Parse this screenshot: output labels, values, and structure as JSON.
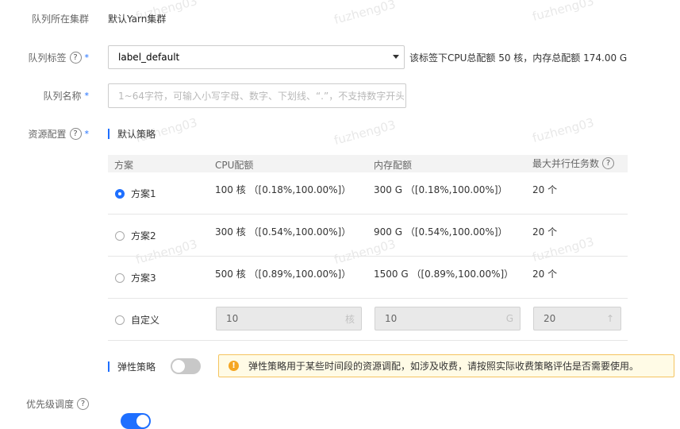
{
  "fields": {
    "cluster": {
      "label": "队列所在集群",
      "value": "默认Yarn集群"
    },
    "tag": {
      "label": "队列标签",
      "help": "?",
      "required": "*",
      "selected": "label_default",
      "note": "该标签下CPU总配额 50 核，内存总配额 174.00 G"
    },
    "name": {
      "label": "队列名称",
      "required": "*",
      "placeholder": "1~64字符，可输入小写字母、数字、下划线、“.”，不支持数字开头"
    },
    "resource": {
      "label": "资源配置",
      "help": "?",
      "required": "*",
      "section_title": "默认策略"
    }
  },
  "table": {
    "headers": {
      "plan": "方案",
      "cpu": "CPU配额",
      "mem": "内存配额",
      "max_tasks": "最大并行任务数",
      "max_help": "?"
    },
    "rows": [
      {
        "plan": "方案1",
        "cpu": "100 核 （[0.18%,100.00%]）",
        "mem": "300 G （[0.18%,100.00%]）",
        "tasks": "20 个",
        "selected": true
      },
      {
        "plan": "方案2",
        "cpu": "300 核 （[0.54%,100.00%]）",
        "mem": "900 G （[0.54%,100.00%]）",
        "tasks": "20 个",
        "selected": false
      },
      {
        "plan": "方案3",
        "cpu": "500 核 （[0.89%,100.00%]）",
        "mem": "1500 G （[0.89%,100.00%]）",
        "tasks": "20 个",
        "selected": false
      }
    ],
    "custom": {
      "label": "自定义",
      "cpu_value": "10",
      "cpu_unit": "核",
      "mem_value": "10",
      "mem_unit": "G",
      "tasks_value": "20",
      "tasks_arrow": "↑"
    }
  },
  "elastic": {
    "label": "弹性策略",
    "enabled": false,
    "alert": "弹性策略用于某些时间段的资源调配，如涉及收费，请按照实际收费策略评估是否需要使用。",
    "alert_icon": "!"
  },
  "priority": {
    "label": "优先级调度",
    "help": "?",
    "enabled": true
  },
  "watermark": "fuzheng03",
  "colors": {
    "accent": "#1e6fff",
    "warning": "#f5a623",
    "alert_bg": "#fffbe6"
  }
}
